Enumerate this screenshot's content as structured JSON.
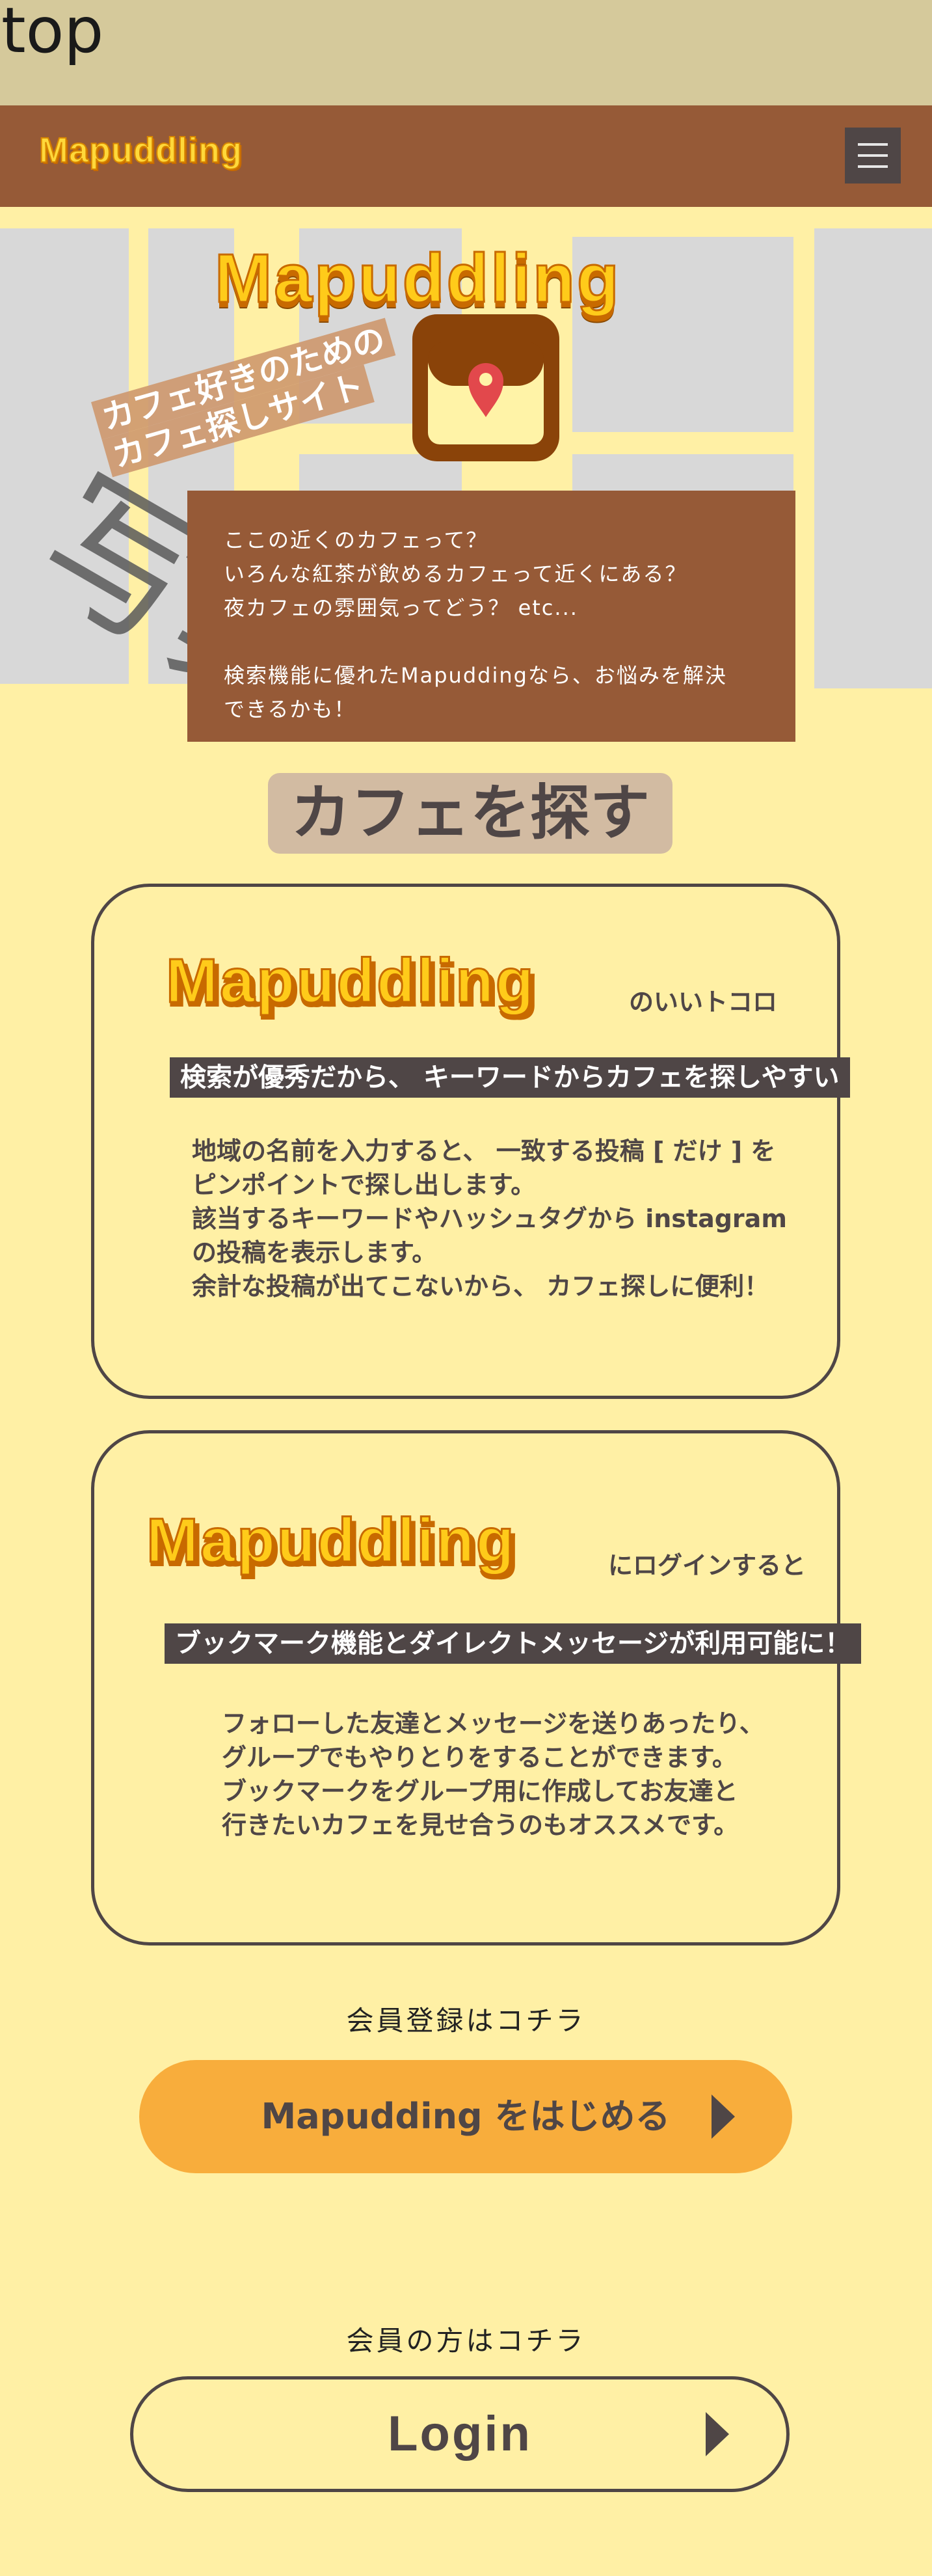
{
  "page_label": "top",
  "header": {
    "logo": "Mapuddling"
  },
  "hero": {
    "title": "Mapuddling",
    "tagline_line1": "カフェ好きのための",
    "tagline_line2": "カフェ探しサイト",
    "watermark": "写真写真写真",
    "intro_lines": [
      "ここの近くのカフェって？",
      "いろんな紅茶が飲めるカフェって近くにある？",
      "夜カフェの雰囲気ってどう？ etc...",
      "検索機能に優れたMapuddingなら、お悩みを解決",
      "できるかも！"
    ]
  },
  "section_title": "カフェを探す",
  "card1": {
    "logo": "Mapuddling",
    "logo_suffix": "のいいトコロ",
    "subtitle": "検索が優秀だから、 キーワードからカフェを探しやすい",
    "body": [
      "地域の名前を入力すると、 一致する投稿 [ だけ ] を",
      "ピンポイントで探し出します。",
      "該当するキーワードやハッシュタグから instagram",
      "の投稿を表示します。",
      "余計な投稿が出てこないから、 カフェ探しに便利！"
    ]
  },
  "card2": {
    "logo": "Mapuddling",
    "logo_suffix": "にログインすると",
    "subtitle": "ブックマーク機能とダイレクトメッセージが利用可能に！",
    "body": [
      "フォローした友達とメッセージを送りあったり、",
      "グループでもやりとりをすることができます。",
      "ブックマークをグループ用に作成してお友達と",
      "行きたいカフェを見せ合うのもオススメです。"
    ]
  },
  "register": {
    "label": "会員登録はコチラ",
    "button": "Mapudding をはじめる"
  },
  "login": {
    "label": "会員の方はコチラ",
    "button": "Login"
  },
  "colors": {
    "background": "#fff0a5",
    "header": "#965a37",
    "accent": "#f8ad3c",
    "dark": "#4f4646"
  }
}
